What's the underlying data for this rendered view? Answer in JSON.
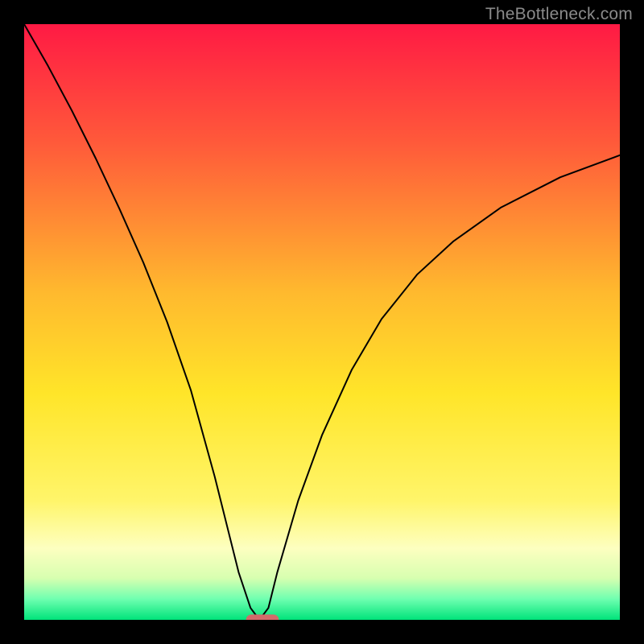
{
  "watermark": "TheBottleneck.com",
  "chart_data": {
    "type": "line",
    "title": "",
    "xlabel": "",
    "ylabel": "",
    "xlim": [
      0,
      100
    ],
    "ylim": [
      0,
      100
    ],
    "grid": false,
    "legend": false,
    "background_gradient_stops": [
      {
        "offset": 0.0,
        "color": "#ff1a44"
      },
      {
        "offset": 0.2,
        "color": "#ff5a3a"
      },
      {
        "offset": 0.45,
        "color": "#ffb92e"
      },
      {
        "offset": 0.62,
        "color": "#ffe529"
      },
      {
        "offset": 0.8,
        "color": "#fff56a"
      },
      {
        "offset": 0.88,
        "color": "#fdffc0"
      },
      {
        "offset": 0.93,
        "color": "#d7ffb0"
      },
      {
        "offset": 0.965,
        "color": "#6fffb0"
      },
      {
        "offset": 1.0,
        "color": "#00e37a"
      }
    ],
    "series": [
      {
        "name": "bottleneck-curve",
        "color": "#000000",
        "width": 2,
        "x": [
          0,
          4,
          8,
          12,
          16,
          20,
          24,
          28,
          32,
          34,
          36,
          38,
          39.5,
          41,
          42.5,
          46,
          50,
          55,
          60,
          66,
          72,
          80,
          90,
          100
        ],
        "y": [
          100,
          93,
          85.5,
          77.5,
          69,
          60,
          50,
          38.5,
          24,
          16,
          8,
          2,
          0,
          2,
          8,
          20,
          31,
          42,
          50.5,
          58,
          63.5,
          69.2,
          74.3,
          78
        ]
      }
    ],
    "marker": {
      "name": "min-marker",
      "shape": "rounded-rect",
      "color": "#d36a6a",
      "cx": 40,
      "cy": 0,
      "width_frac": 0.055,
      "height_frac": 0.018,
      "corner_frac": 0.009
    }
  }
}
